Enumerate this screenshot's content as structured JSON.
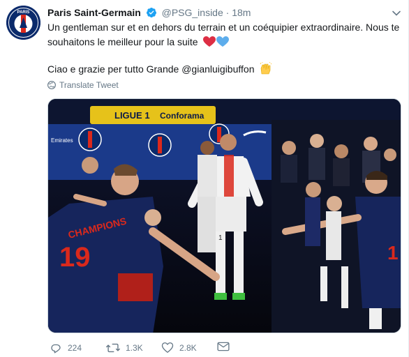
{
  "tweet": {
    "author_name": "Paris Saint-Germain",
    "handle": "@PSG_inside",
    "separator": "·",
    "time": "18m",
    "line1": "Un gentleman sur et en dehors du terrain et un coéquipier extraordinaire. Nous te",
    "line2": "souhaitons le meilleur pour la suite",
    "line3": "Ciao e grazie per tutto Grande @gianluigibuffon",
    "translate": "Translate Tweet",
    "avatar_text": "PARIS",
    "avatar_sub": "SAINT-GERMAIN"
  },
  "media": {
    "banner_text": "LIGUE 1",
    "banner_sponsor": "Conforama",
    "jersey_left_name": "CHAMPIONS",
    "jersey_left_number": "19",
    "player_number": "1",
    "right_jersey_number": "1",
    "sponsor": "Emirates"
  },
  "actions": {
    "reply_count": "224",
    "retweet_count": "1.3K",
    "like_count": "2.8K"
  },
  "colors": {
    "psg_navy": "#0a2a6b",
    "psg_red": "#da291c",
    "ligue1_yellow": "#e6c21a",
    "meta_gray": "#657786",
    "verified_blue": "#1da1f2"
  }
}
